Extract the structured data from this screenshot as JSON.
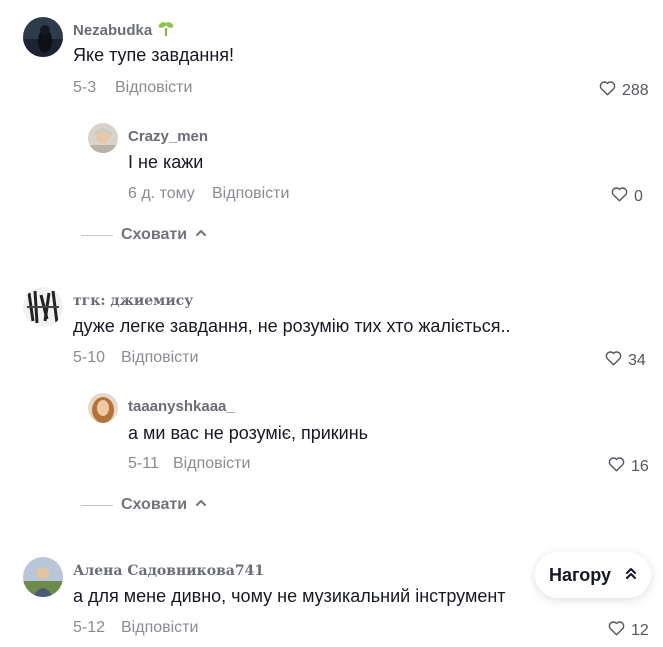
{
  "comments": [
    {
      "username": "Nezabudka",
      "username_emoji": "seedling-icon",
      "text": "Яке тупе завдання!",
      "date": "5-3",
      "reply_label": "Відповісти",
      "likes": "288",
      "replies": [
        {
          "username": "Crazy_men",
          "text": "І не кажи",
          "date": "6 д. тому",
          "reply_label": "Відповісти",
          "likes": "0"
        }
      ],
      "hide_label": "Сховати"
    },
    {
      "username": "тгк: джиемису",
      "text": "дуже легке завдання, не розумію тих хто жаліється..",
      "date": "5-10",
      "reply_label": "Відповісти",
      "likes": "34",
      "replies": [
        {
          "username": "taaanyshkaaa_",
          "text": "а ми вас не розуміє, прикинь",
          "date": "5-11",
          "reply_label": "Відповісти",
          "likes": "16"
        }
      ],
      "hide_label": "Сховати"
    },
    {
      "username": "Алена Садовникова741",
      "text": "а для мене дивно, чому не музикальний інструмент",
      "date": "5-12",
      "reply_label": "Відповісти",
      "likes": "12"
    }
  ],
  "back_to_top": {
    "label": "Нагору",
    "icon": "double-chevron-up-icon"
  },
  "colors": {
    "text": "#161823",
    "muted": "#8a8b91",
    "username": "#6b6d75"
  }
}
